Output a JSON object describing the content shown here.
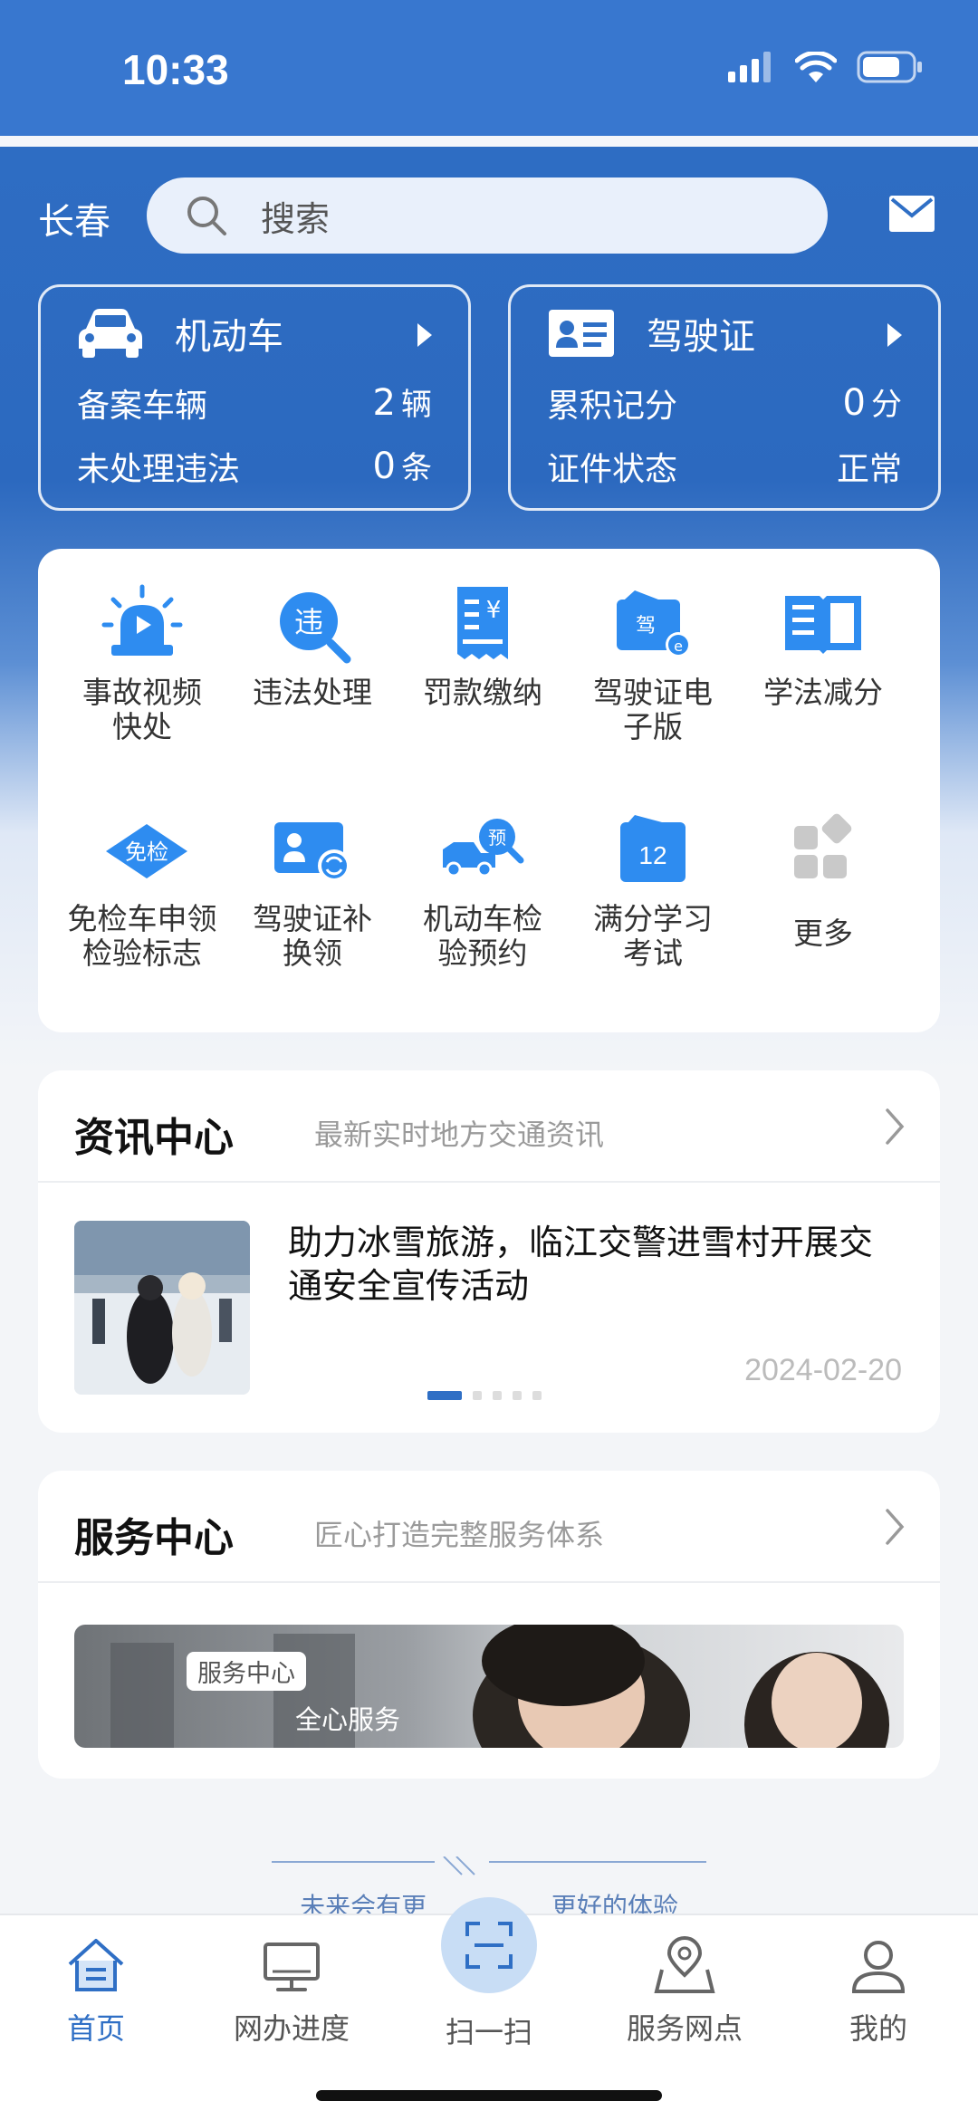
{
  "status": {
    "time": "10:33"
  },
  "header": {
    "city": "长春",
    "search_placeholder": "搜索"
  },
  "vehicle_card": {
    "title": "机动车",
    "rows": [
      {
        "label": "备案车辆",
        "value": "2",
        "unit": "辆"
      },
      {
        "label": "未处理违法",
        "value": "0",
        "unit": "条"
      }
    ]
  },
  "license_card": {
    "title": "驾驶证",
    "rows": [
      {
        "label": "累积记分",
        "value": "0",
        "unit": "分"
      },
      {
        "label": "证件状态",
        "value": "正常",
        "unit": ""
      }
    ]
  },
  "services": [
    {
      "l1": "事故视频",
      "l2": "快处",
      "icon": "siren-video-icon"
    },
    {
      "l1": "违法处理",
      "l2": "",
      "icon": "violation-search-icon"
    },
    {
      "l1": "罚款缴纳",
      "l2": "",
      "icon": "fine-receipt-icon"
    },
    {
      "l1": "驾驶证电",
      "l2": "子版",
      "icon": "e-license-icon"
    },
    {
      "l1": "学法减分",
      "l2": "",
      "icon": "open-book-icon"
    },
    {
      "l1": "免检车申领",
      "l2": "检验标志",
      "icon": "exempt-badge-icon"
    },
    {
      "l1": "驾驶证补",
      "l2": "换领",
      "icon": "license-renew-icon"
    },
    {
      "l1": "机动车检",
      "l2": "验预约",
      "icon": "inspection-booking-icon"
    },
    {
      "l1": "满分学习",
      "l2": "考试",
      "icon": "calendar-12-icon"
    },
    {
      "l1": "更多",
      "l2": "",
      "icon": "more-grid-icon"
    }
  ],
  "news": {
    "heading": "资讯中心",
    "subtitle": "最新实时地方交通资讯",
    "title": "助力冰雪旅游，临江交警进雪村开展交通安全宣传活动",
    "date": "2024-02-20"
  },
  "service_center": {
    "heading": "服务中心",
    "subtitle": "匠心打造完整服务体系",
    "banner_tag": "服务中心",
    "banner_text": "全心服务"
  },
  "footer_note": {
    "left": "未来会有更",
    "right": "更好的体验"
  },
  "tabbar": [
    {
      "label": "首页",
      "icon": "home-icon"
    },
    {
      "label": "网办进度",
      "icon": "monitor-icon"
    },
    {
      "label": "扫一扫",
      "icon": "scan-icon"
    },
    {
      "label": "服务网点",
      "icon": "map-pin-icon"
    },
    {
      "label": "我的",
      "icon": "profile-icon"
    }
  ],
  "colors": {
    "primary": "#2f6fc5",
    "accent_light": "#c8ddf5"
  }
}
